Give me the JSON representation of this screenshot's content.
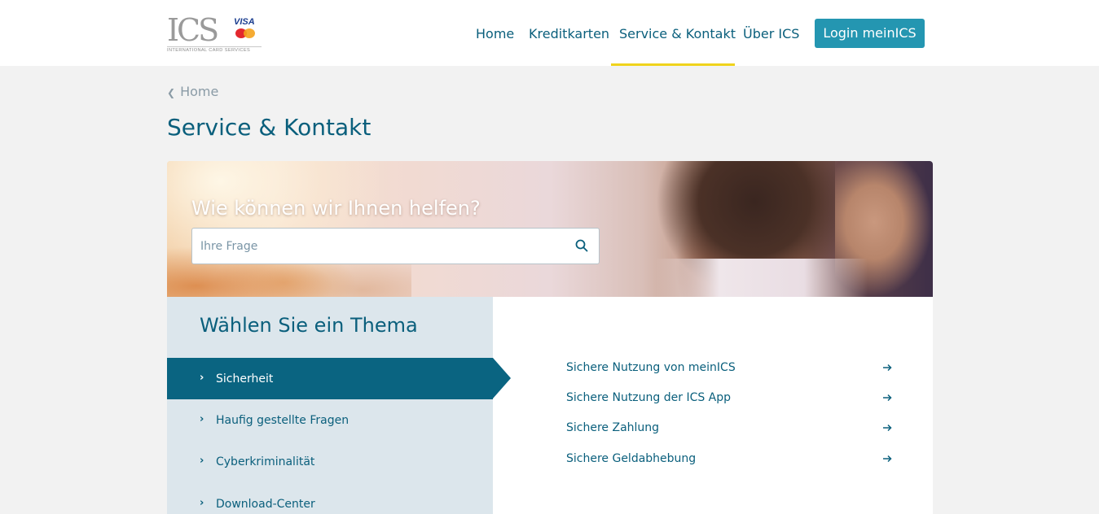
{
  "header": {
    "logo": {
      "text": "ICS",
      "visa": "VISA",
      "tagline": "INTERNATIONAL CARD SERVICES"
    },
    "nav": [
      {
        "label": "Home"
      },
      {
        "label": "Kreditkarten"
      },
      {
        "label": "Service & Kontakt",
        "active": true
      },
      {
        "label": "Über ICS"
      }
    ],
    "login_label": "Login meinICS",
    "accent_color": "#f0d31c",
    "login_color": "#2496b1"
  },
  "breadcrumb": {
    "label": "Home"
  },
  "page_title": "Service & Kontakt",
  "hero": {
    "question": "Wie können wir Ihnen helfen?",
    "search_placeholder": "Ihre Frage",
    "search_value": ""
  },
  "topics": {
    "heading": "Wählen Sie ein Thema",
    "items": [
      {
        "label": "Sicherheit",
        "active": true
      },
      {
        "label": "Haufig gestellte Fragen"
      },
      {
        "label": "Cyberkriminalität"
      },
      {
        "label": "Download-Center"
      }
    ]
  },
  "links": [
    {
      "label": "Sichere Nutzung von meinICS"
    },
    {
      "label": "Sichere Nutzung der ICS App"
    },
    {
      "label": "Sichere Zahlung"
    },
    {
      "label": "Sichere Geldabhebung"
    }
  ],
  "colors": {
    "primary_text": "#0a5f7c",
    "active_topic": "#0a6481",
    "topic_panel": "#dce6ec",
    "page_bg": "#f2f2f2"
  }
}
